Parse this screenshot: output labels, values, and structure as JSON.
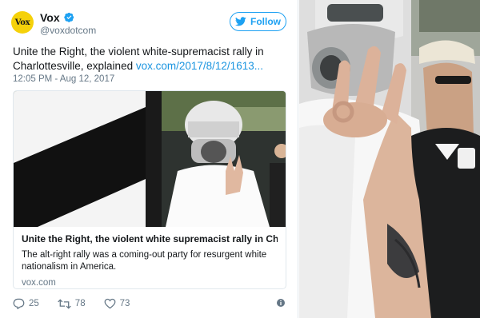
{
  "tweet": {
    "avatar_text": "Vox",
    "display_name": "Vox",
    "handle": "@voxdotcom",
    "follow_label": "Follow",
    "text": "Unite the Right, the violent white-supremacist rally in Charlottesville, explained",
    "link": "vox.com/2017/8/12/1613...",
    "timestamp": "12:05 PM - Aug 12, 2017",
    "card": {
      "title": "Unite the Right, the violent white supremacist rally in Cha...",
      "description": "The alt-right rally was a coming-out party for resurgent white nationalism in America.",
      "domain": "vox.com"
    },
    "actions": {
      "replies": "25",
      "retweets": "78",
      "likes": "73"
    }
  },
  "colors": {
    "accent": "#1da1f2",
    "link": "#1b95e0",
    "muted": "#657786",
    "avatar_bg": "#f5d10a"
  }
}
